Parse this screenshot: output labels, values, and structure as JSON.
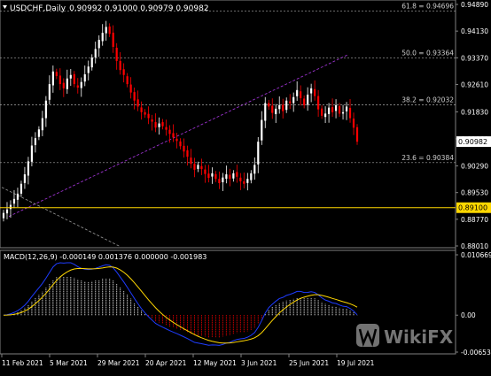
{
  "window": {
    "title": "USDCHF,Daily",
    "ohlc": "0.90992 0.91000 0.90979 0.90982"
  },
  "price_axis": {
    "ticks": [
      "0.94890",
      "0.94130",
      "0.93370",
      "0.92610",
      "0.91830",
      "0.91060",
      "0.90290",
      "0.89530",
      "0.88770",
      "0.88010"
    ],
    "current_price": "0.90982",
    "horizontal_line_price": "0.89100"
  },
  "fibonacci": [
    {
      "label": "61.8 = 0.94696",
      "price": 0.94696
    },
    {
      "label": "50.0 = 0.93364",
      "price": 0.93364
    },
    {
      "label": "38.2 = 0.92032",
      "price": 0.92032
    },
    {
      "label": "23.6 = 0.90384",
      "price": 0.90384
    }
  ],
  "macd_panel": {
    "label": "MACD(12,26,9) -0.000149 0.001376 0.000000 -0.001983",
    "ticks": [
      "0.010669",
      "0.00",
      "-0.006531"
    ]
  },
  "time_axis": {
    "labels": [
      "11 Feb 2021",
      "5 Mar 2021",
      "29 Mar 2021",
      "20 Apr 2021",
      "12 May 2021",
      "3 Jun 2021",
      "25 Jun 2021",
      "19 Jul 2021"
    ]
  },
  "watermark": {
    "text": "WikiFX"
  },
  "colors": {
    "background": "#000000",
    "bull": "#ffffff",
    "bear": "#ff0000",
    "grid": "#808080",
    "hline": "#ffd700",
    "trendline": "#9932cc",
    "macd_signal": "#ffd700",
    "macd_main": "#1e3cff",
    "hist_up": "#ffffff",
    "hist_down": "#ff0000"
  },
  "chart_data": {
    "type": "candlestick",
    "symbol": "USDCHF",
    "timeframe": "Daily",
    "ylim": [
      0.8801,
      0.9489
    ],
    "closes": [
      0.8895,
      0.8905,
      0.8918,
      0.8935,
      0.895,
      0.8978,
      0.9005,
      0.9042,
      0.9087,
      0.9108,
      0.9133,
      0.9165,
      0.9215,
      0.9262,
      0.9298,
      0.9285,
      0.9262,
      0.925,
      0.9278,
      0.9288,
      0.9262,
      0.9252,
      0.9268,
      0.929,
      0.9312,
      0.9338,
      0.9362,
      0.9388,
      0.9408,
      0.9425,
      0.9405,
      0.9368,
      0.9328,
      0.9302,
      0.9288,
      0.9262,
      0.9238,
      0.9215,
      0.9198,
      0.9182,
      0.9175,
      0.9165,
      0.9155,
      0.9138,
      0.915,
      0.9142,
      0.9132,
      0.912,
      0.911,
      0.91,
      0.9085,
      0.907,
      0.9055,
      0.9035,
      0.9018,
      0.9032,
      0.902,
      0.9006,
      0.8995,
      0.9008,
      0.8992,
      0.898,
      0.8996,
      0.9005,
      0.8992,
      0.9008,
      0.8998,
      0.8985,
      0.8978,
      0.8992,
      0.9008,
      0.9032,
      0.9098,
      0.916,
      0.9208,
      0.9198,
      0.918,
      0.9192,
      0.9202,
      0.9185,
      0.9215,
      0.9208,
      0.9225,
      0.9245,
      0.9222,
      0.9202,
      0.9232,
      0.925,
      0.9228,
      0.919,
      0.9172,
      0.9178,
      0.9195,
      0.9182,
      0.9202,
      0.9178,
      0.9182,
      0.9198,
      0.9165,
      0.9138,
      0.9098
    ]
  }
}
